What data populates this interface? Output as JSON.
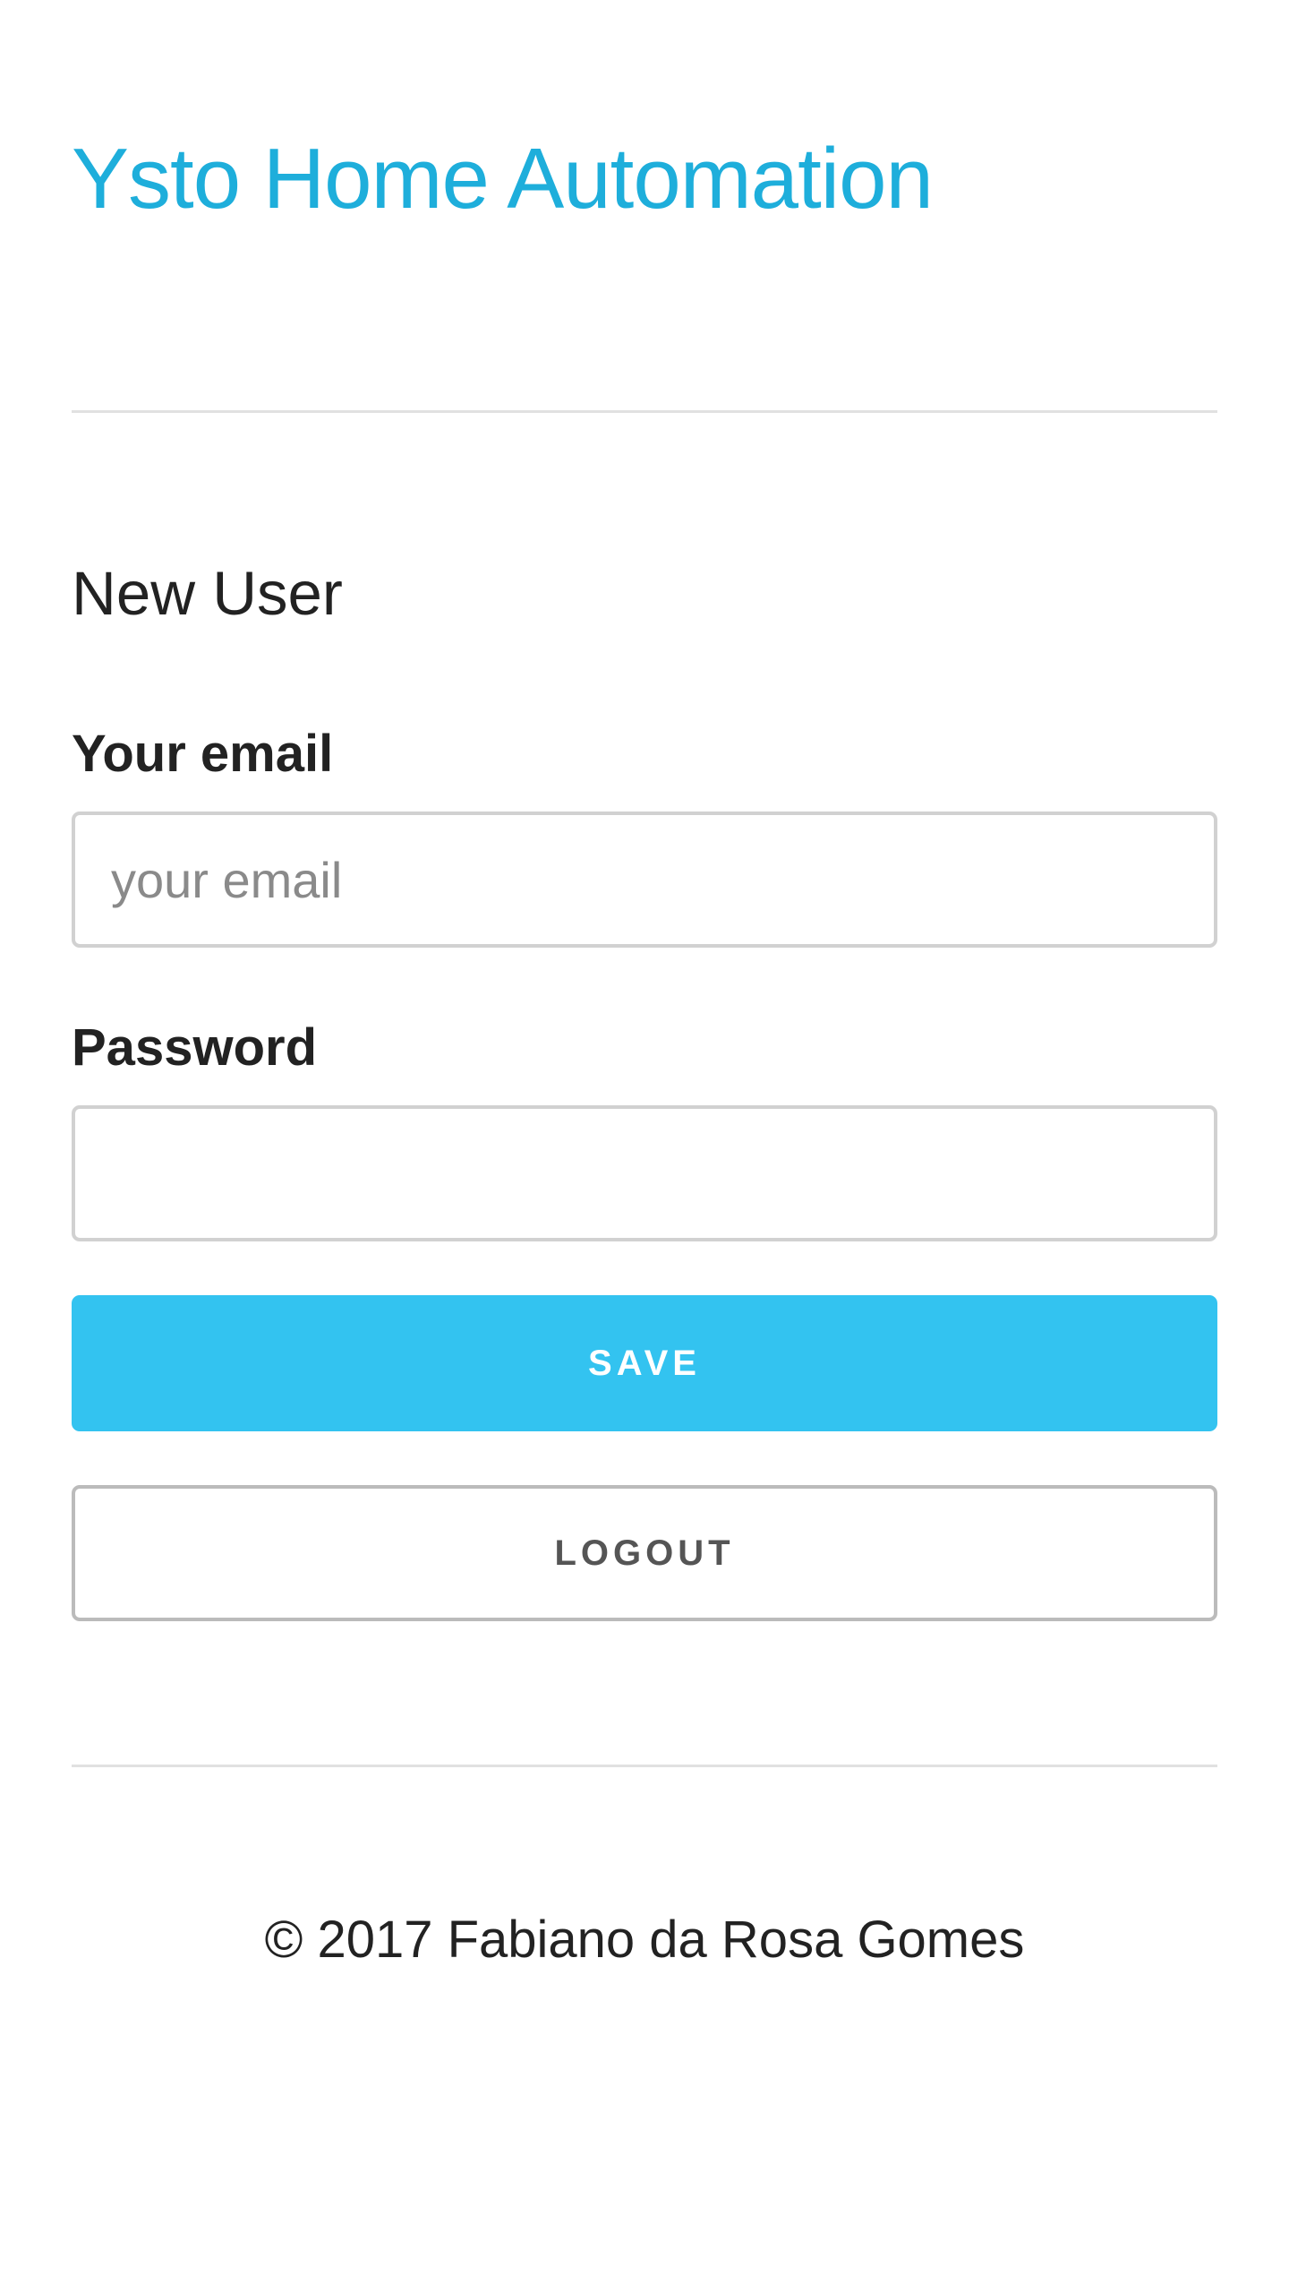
{
  "header": {
    "title": "Ysto Home Automation"
  },
  "form": {
    "heading": "New User",
    "email": {
      "label": "Your email",
      "placeholder": "your email",
      "value": ""
    },
    "password": {
      "label": "Password",
      "value": ""
    },
    "save_label": "SAVE",
    "logout_label": "LOGOUT"
  },
  "footer": {
    "copyright": "© 2017 Fabiano da Rosa Gomes"
  },
  "colors": {
    "accent": "#1eaedb",
    "primary_button": "#33c3f0",
    "divider": "#e1e1e1",
    "text": "#222222"
  }
}
